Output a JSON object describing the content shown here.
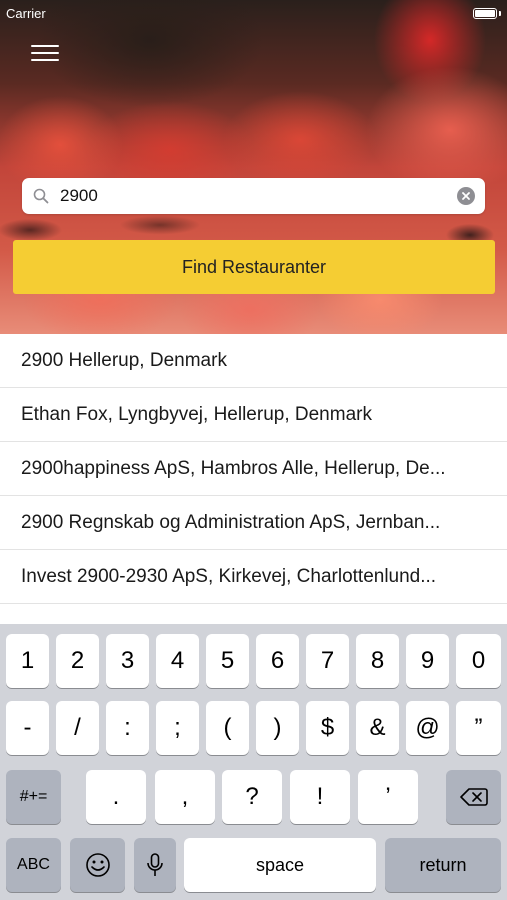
{
  "status_bar": {
    "carrier": "Carrier"
  },
  "search": {
    "value": "2900",
    "placeholder": ""
  },
  "find_button_label": "Find Restauranter",
  "results": [
    "2900 Hellerup, Denmark",
    "Ethan Fox, Lyngbyvej, Hellerup, Denmark",
    "2900happiness ApS, Hambros Alle, Hellerup, De...",
    "2900 Regnskab og Administration ApS, Jernban...",
    "Invest 2900-2930 ApS, Kirkevej, Charlottenlund..."
  ],
  "keyboard": {
    "row1": [
      "1",
      "2",
      "3",
      "4",
      "5",
      "6",
      "7",
      "8",
      "9",
      "0"
    ],
    "row2": [
      "-",
      "/",
      ":",
      ";",
      "(",
      ")",
      "$",
      "&",
      "@",
      "”"
    ],
    "row3": {
      "symbols": "#+=",
      "keys": [
        ".",
        ",",
        "?",
        "!",
        "’"
      ]
    },
    "row4": {
      "abc": "ABC",
      "space": "space",
      "return": "return"
    }
  },
  "colors": {
    "accent": "#f5cd33",
    "keyboard_bg": "#d1d3d9"
  }
}
